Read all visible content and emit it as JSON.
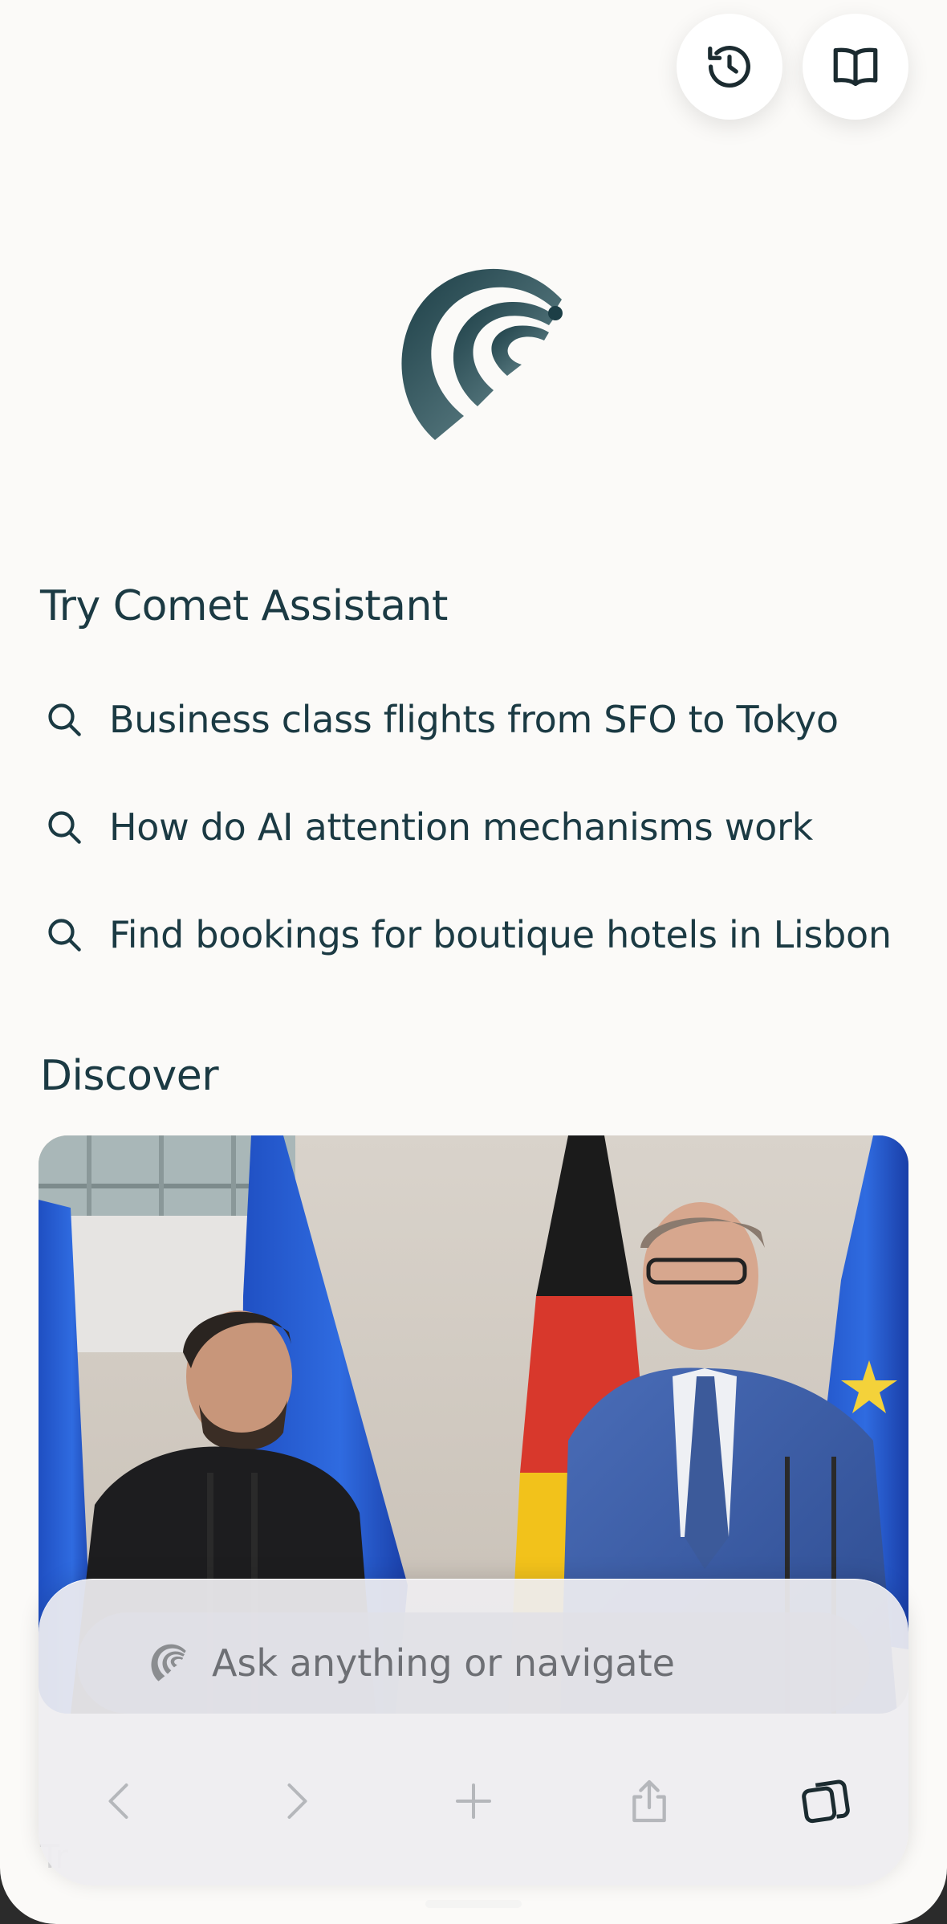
{
  "header": {
    "history_button_icon": "history-icon",
    "library_button_icon": "book-icon"
  },
  "brand": {
    "logo_icon": "comet-logo-icon",
    "color": "#294a52"
  },
  "assistant": {
    "title": "Try Comet Assistant",
    "suggestions": [
      {
        "icon": "search-icon",
        "text": "Business class flights from SFO to Tokyo"
      },
      {
        "icon": "search-icon",
        "text": "How do AI attention mechanisms work"
      },
      {
        "icon": "search-icon",
        "text": "Find bookings for boutique hotels in Lisbon"
      }
    ]
  },
  "discover": {
    "title": "Discover",
    "card": {
      "image": "news photo: two leaders at podiums with EU, Ukrainian and German flags"
    },
    "peek_text": "Tr"
  },
  "bottom_bar": {
    "search": {
      "icon": "comet-icon",
      "placeholder": "Ask anything or navigate"
    },
    "nav": [
      {
        "icon": "chevron-left-icon"
      },
      {
        "icon": "chevron-right-icon"
      },
      {
        "icon": "plus-icon"
      },
      {
        "icon": "share-icon"
      },
      {
        "icon": "tabs-icon"
      }
    ]
  },
  "colors": {
    "text": "#1b3a43",
    "background": "#fbfaf8",
    "accent": "#294a52"
  }
}
